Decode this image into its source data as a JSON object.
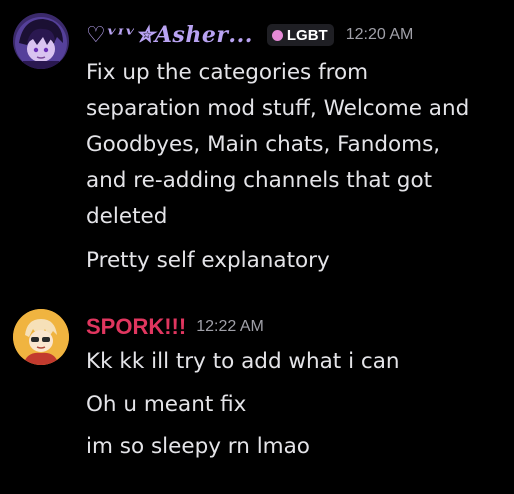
{
  "messages": [
    {
      "username": "♡ᵛᶦᵛ✮𝑨𝒔𝒉𝒆𝒓...",
      "role_tag": "LGBT",
      "role_color": "#e58ad6",
      "name_color": "#b9a3f2",
      "timestamp": "12:20 AM",
      "lines": [
        "Fix up the categories from",
        "separation mod stuff, Welcome and",
        "Goodbyes, Main chats, Fandoms,",
        "and re-adding channels that got",
        "deleted",
        "Pretty self explanatory"
      ]
    },
    {
      "username": "SPORK!!!",
      "name_color": "#e0365f",
      "timestamp": "12:22 AM",
      "lines": [
        "Kk kk ill try to add what i can",
        "Oh u meant fix",
        "im so sleepy rn lmao"
      ]
    }
  ]
}
